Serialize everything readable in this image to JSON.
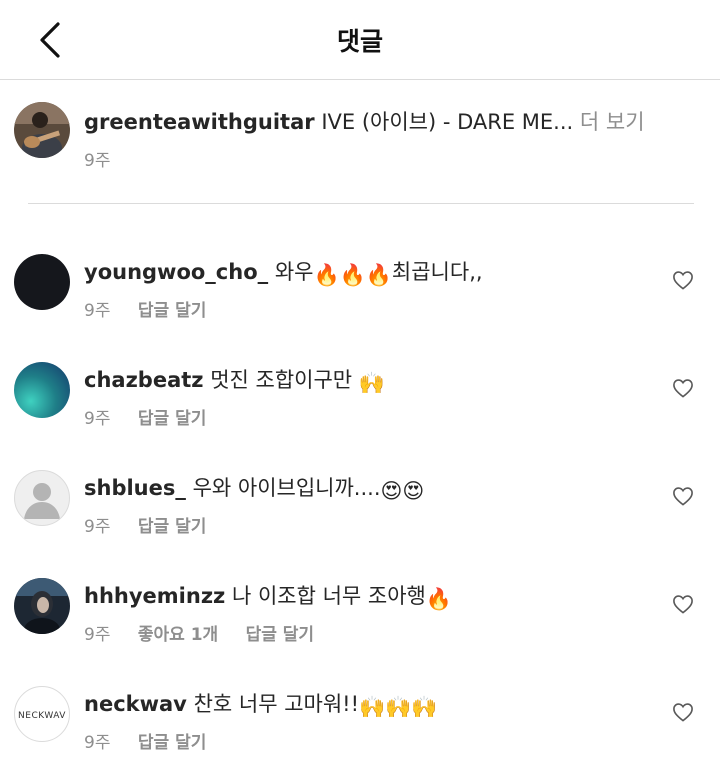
{
  "header": {
    "back_icon": "chevron-left-icon",
    "title": "댓글"
  },
  "caption": {
    "username": "greenteawithguitar",
    "text": "IVE (아이브) - DARE ME...",
    "more": "더 보기",
    "time": "9주"
  },
  "comments": [
    {
      "username": "youngwoo_cho_",
      "text_before": "와우",
      "text_after": "최곱니다,,",
      "time": "9주",
      "reply": "답글 달기",
      "emoji": "fire-emoji x3"
    },
    {
      "username": "chazbeatz",
      "text_before": "멋진 조합이구만",
      "time": "9주",
      "reply": "답글 달기",
      "emoji": "raising-hands-emoji"
    },
    {
      "username": "shblues_",
      "text_before": "우와 아이브입니까....",
      "time": "9주",
      "reply": "답글 달기",
      "emoji": "heart-eyes-emoji x2"
    },
    {
      "username": "hhhyeminzz",
      "text_before": "나 이조합 너무 조아행",
      "time": "9주",
      "likes": "좋아요 1개",
      "reply": "답글 달기",
      "emoji": "fire-emoji"
    },
    {
      "username": "neckwav",
      "text_before": "찬호 너무 고마워!!",
      "time": "9주",
      "reply": "답글 달기",
      "emoji": "raising-hands-emoji x3",
      "avatar_logo": "NECKWAV"
    }
  ],
  "colors": {
    "text": "#262626",
    "secondary": "#8e8e8e",
    "divider": "#dbdbdb"
  }
}
